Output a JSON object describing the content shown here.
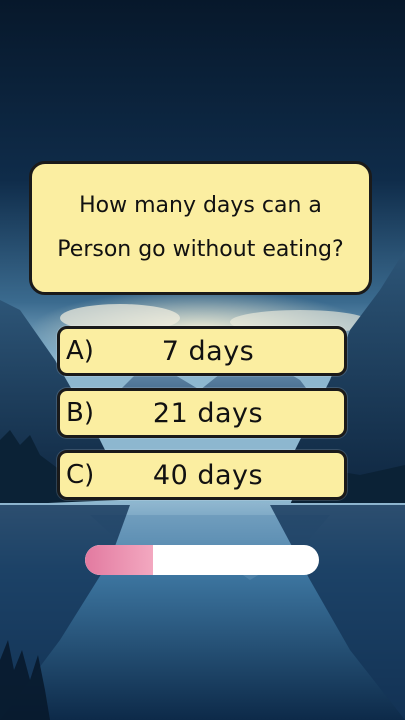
{
  "question": {
    "text": "How many days can a Person go without eating?"
  },
  "options": [
    {
      "letter": "A)",
      "text": "7 days"
    },
    {
      "letter": "B)",
      "text": "21 days"
    },
    {
      "letter": "C)",
      "text": "40 days"
    }
  ],
  "timer": {
    "progress": 0.29,
    "fill_color": "#e27aa0",
    "track_color": "#ffffff"
  },
  "colors": {
    "card": "#fbeea1",
    "border": "#1a1a1a"
  }
}
